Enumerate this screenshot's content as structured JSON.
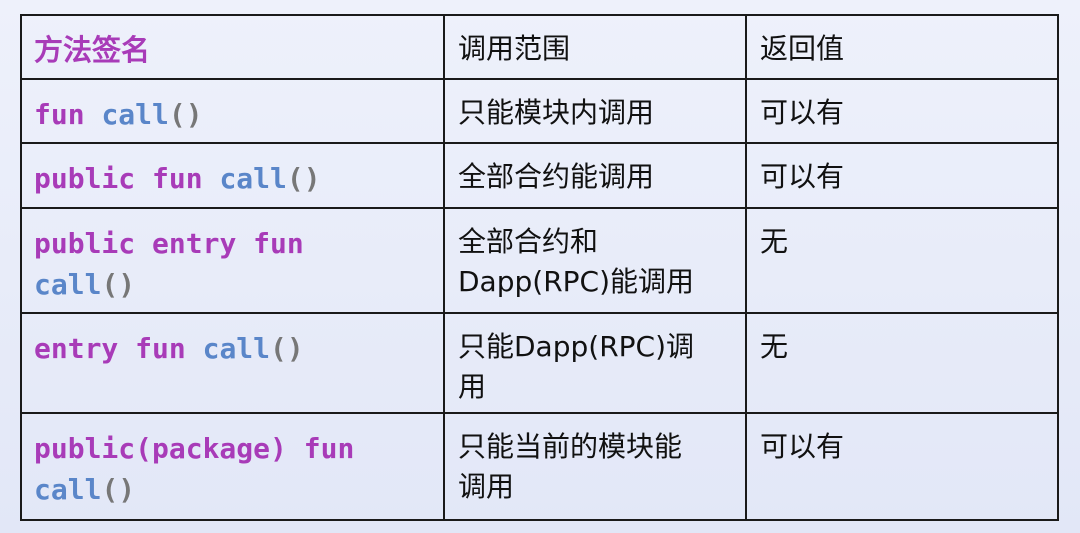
{
  "table": {
    "headers": [
      "方法签名",
      "调用范围",
      "返回值"
    ],
    "rows": [
      {
        "signature_tokens": [
          {
            "t": "fun",
            "k": "kw"
          },
          {
            "t": " ",
            "k": "sp"
          },
          {
            "t": "call",
            "k": "fn"
          },
          {
            "t": "()",
            "k": "pn"
          }
        ],
        "scope": "只能模块内调用",
        "returns": "可以有"
      },
      {
        "signature_tokens": [
          {
            "t": "public",
            "k": "kw"
          },
          {
            "t": " ",
            "k": "sp"
          },
          {
            "t": "fun",
            "k": "kw"
          },
          {
            "t": " ",
            "k": "sp"
          },
          {
            "t": "call",
            "k": "fn"
          },
          {
            "t": "()",
            "k": "pn"
          }
        ],
        "scope": "全部合约能调用",
        "returns": "可以有"
      },
      {
        "signature_tokens": [
          {
            "t": "public",
            "k": "kw"
          },
          {
            "t": " ",
            "k": "sp"
          },
          {
            "t": "entry",
            "k": "kw"
          },
          {
            "t": " ",
            "k": "sp"
          },
          {
            "t": "fun",
            "k": "kw"
          },
          {
            "t": "\n",
            "k": "br"
          },
          {
            "t": "call",
            "k": "fn"
          },
          {
            "t": "()",
            "k": "pn"
          }
        ],
        "scope_lines": [
          "全部合约和",
          "Dapp(RPC)能调用"
        ],
        "returns": "无"
      },
      {
        "signature_tokens": [
          {
            "t": "entry",
            "k": "kw"
          },
          {
            "t": " ",
            "k": "sp"
          },
          {
            "t": "fun",
            "k": "kw"
          },
          {
            "t": " ",
            "k": "sp"
          },
          {
            "t": "call",
            "k": "fn"
          },
          {
            "t": "()",
            "k": "pn"
          }
        ],
        "scope_lines": [
          "只能Dapp(RPC)调",
          "用"
        ],
        "returns": "无"
      },
      {
        "signature_tokens": [
          {
            "t": "public(package)",
            "k": "kw"
          },
          {
            "t": " ",
            "k": "sp"
          },
          {
            "t": "fun",
            "k": "kw"
          },
          {
            "t": "\n",
            "k": "br"
          },
          {
            "t": "call",
            "k": "fn"
          },
          {
            "t": "()",
            "k": "pn"
          }
        ],
        "scope_lines": [
          "只能当前的模块能",
          "调用"
        ],
        "returns": "可以有"
      }
    ]
  }
}
